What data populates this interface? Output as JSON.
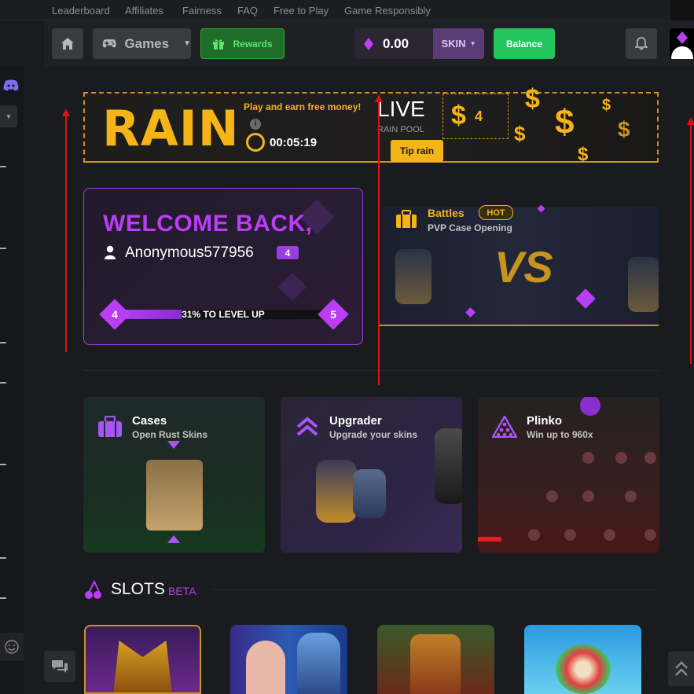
{
  "topnav": {
    "links": [
      "Leaderboard",
      "Affiliates",
      "Fairness",
      "FAQ",
      "Free to Play",
      "Game Responsibly"
    ]
  },
  "header": {
    "games_label": "Games",
    "rewards_label": "Rewards",
    "balance_amount": "0.00",
    "currency_label": "SKIN",
    "balance_button": "Balance"
  },
  "rain": {
    "title": "RAIN",
    "subtitle": "Play and earn free money!",
    "timer": "00:05:19",
    "live_label": "LIVE",
    "pool_label": "RAIN POOL",
    "tip_button": "Tip rain",
    "pool_count": "4"
  },
  "welcome": {
    "title": "WELCOME BACK,",
    "username": "Anonymous577956",
    "level_badge": "4",
    "progress_text": "31% TO LEVEL UP",
    "progress_fraction": 0.31,
    "current_level": "4",
    "next_level": "5"
  },
  "battles": {
    "title": "Battles",
    "badge": "HOT",
    "subtitle": "PVP Case Opening",
    "vs_text": "VS"
  },
  "games": [
    {
      "title": "Cases",
      "subtitle": "Open Rust Skins"
    },
    {
      "title": "Upgrader",
      "subtitle": "Upgrade your skins"
    },
    {
      "title": "Plinko",
      "subtitle": "Win up to 960x"
    }
  ],
  "slots": {
    "title": "SLOTS",
    "badge": "BETA"
  },
  "colors": {
    "accent_purple": "#b93ef5",
    "accent_gold": "#f5b417",
    "accent_green": "#22c55e",
    "background": "#1a1b1e"
  }
}
